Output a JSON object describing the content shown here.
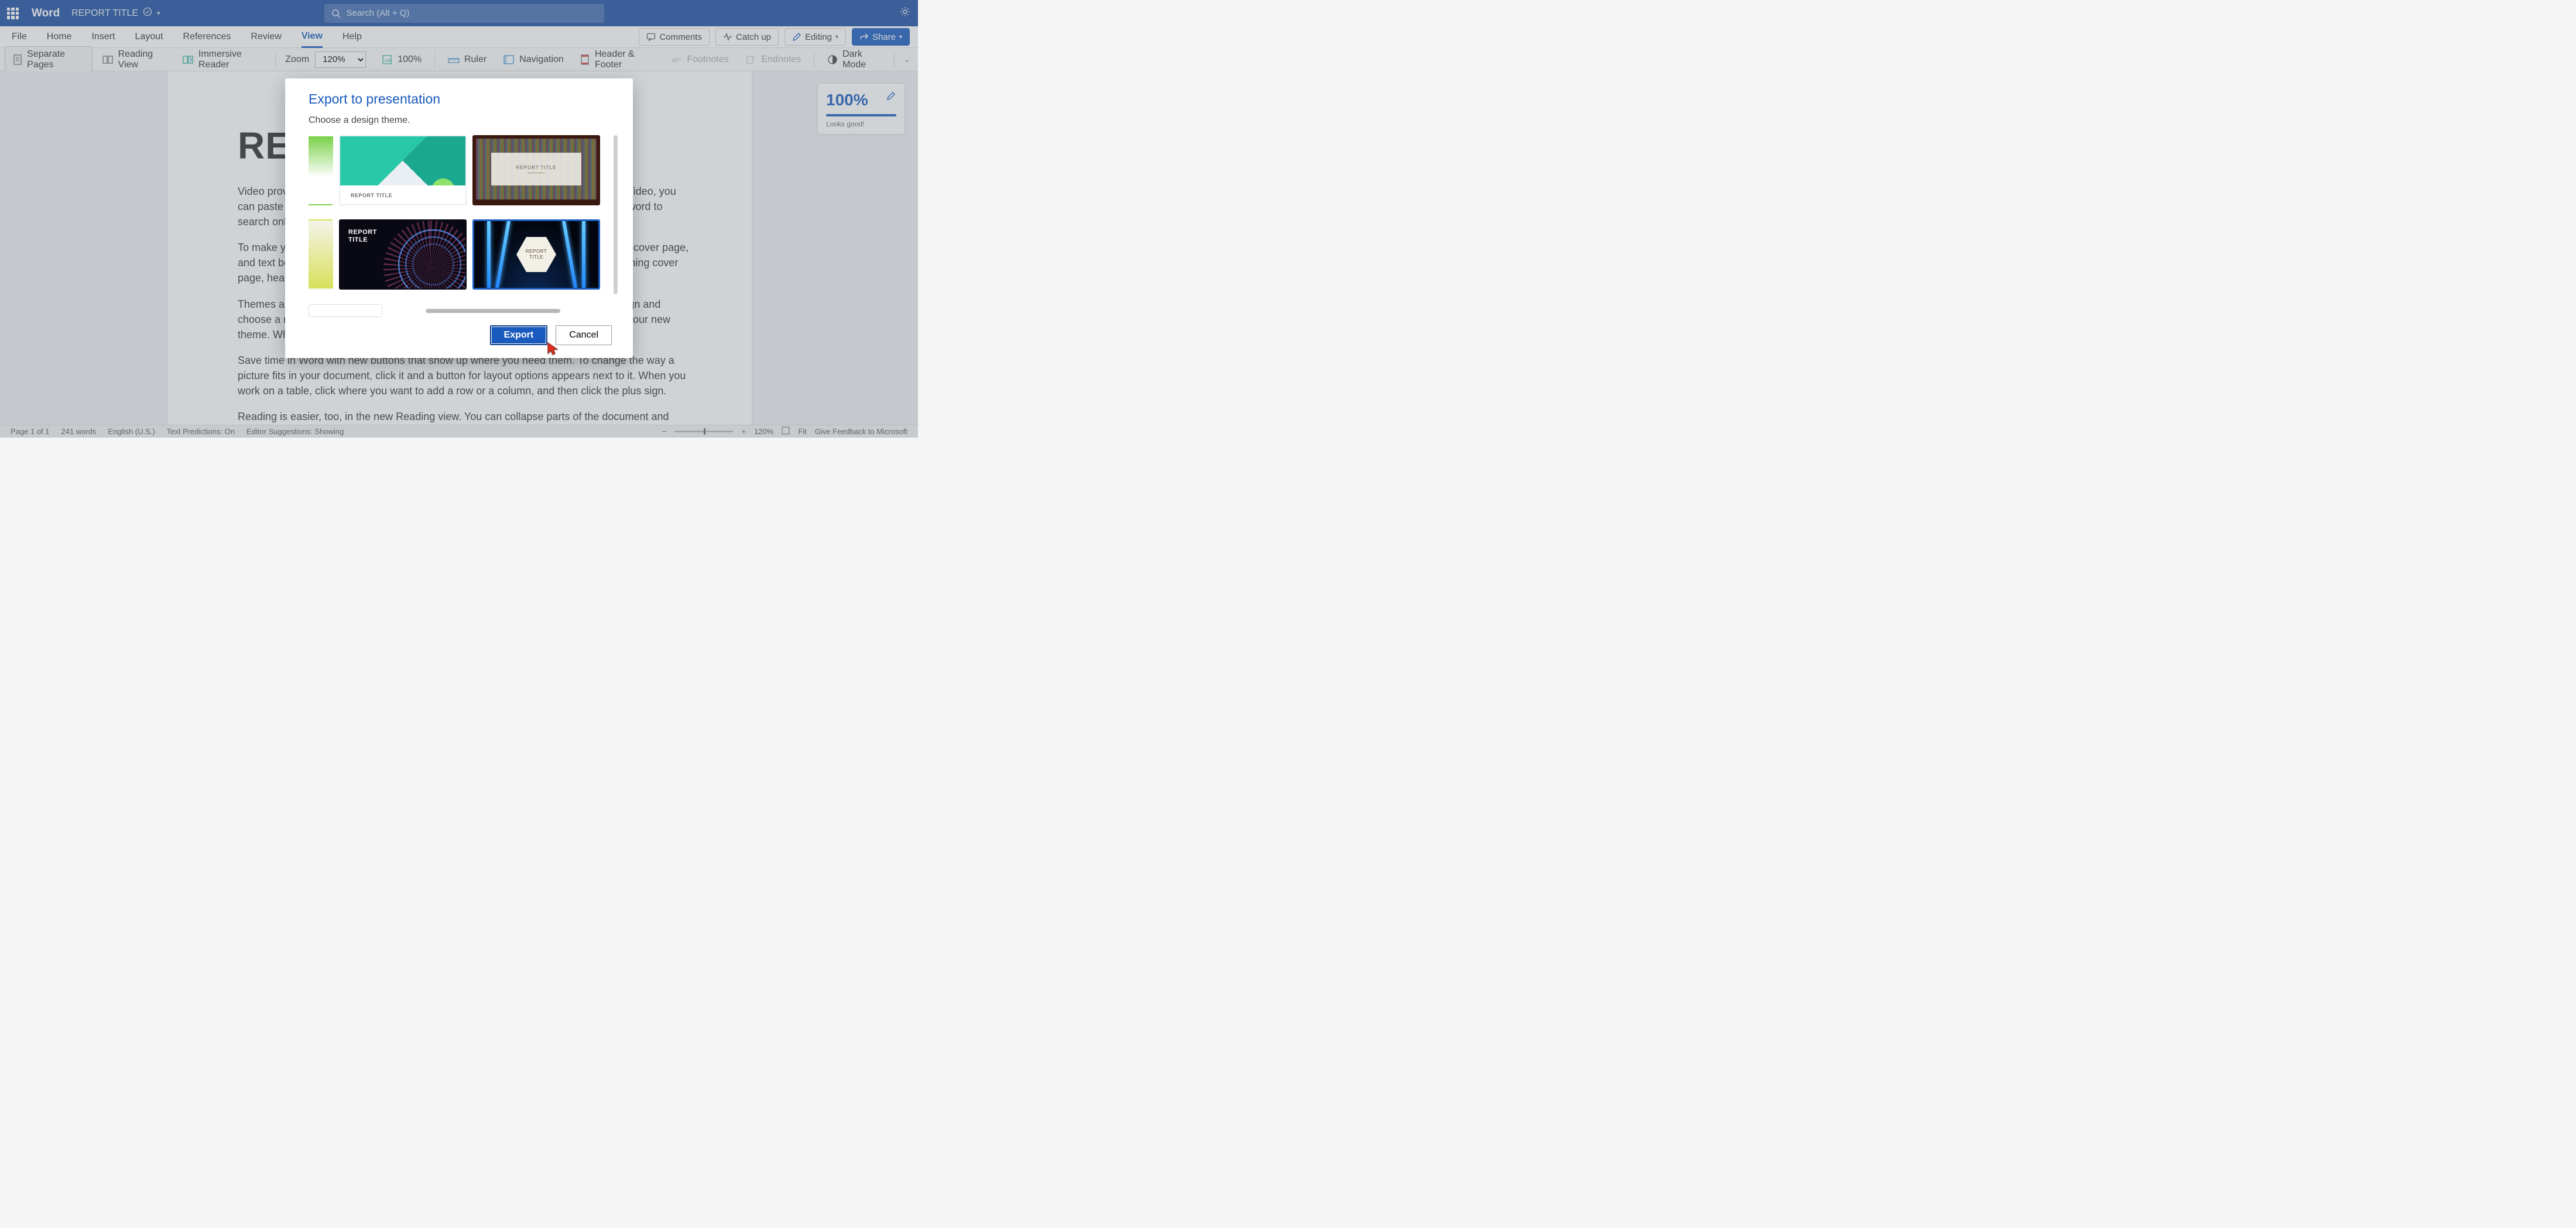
{
  "app": {
    "name": "Word",
    "doc_title": "REPORT TITLE"
  },
  "search": {
    "placeholder": "Search (Alt + Q)"
  },
  "tabs": [
    "File",
    "Home",
    "Insert",
    "Layout",
    "References",
    "Review",
    "View",
    "Help"
  ],
  "tabs_active": "View",
  "tab_actions": {
    "comments": "Comments",
    "catchup": "Catch up",
    "editing": "Editing",
    "share": "Share"
  },
  "ribbon": {
    "separate_pages": "Separate Pages",
    "reading_view": "Reading View",
    "immersive": "Immersive Reader",
    "zoom_label": "Zoom",
    "zoom_value": "120%",
    "hundred": "100%",
    "ruler": "Ruler",
    "navigation": "Navigation",
    "header_footer": "Header & Footer",
    "footnotes": "Footnotes",
    "endnotes": "Endnotes",
    "dark_mode": "Dark Mode"
  },
  "document": {
    "heading": "RE",
    "p1": "Video provides a powerful way to help you prove your point. When you click Online Video, you can paste in the embed code for the video you want to add. You can also type a keyword to search online for the video that best fits your document.",
    "p2": "To make your document look professionally produced, Word provides header, footer, cover page, and text box designs that complement each other. For example, you can add a matching cover page, header, and sidebar.",
    "p3": "Themes and styles also help keep your document coordinated. When you click Design and choose a new Theme, the pictures, charts, and SmartArt graphics change to match your new theme. When you apply styles, your headings change to match the new theme.",
    "p4": "Save time in Word with new buttons that show up where you need them. To change the way a picture fits in your document, click it and a button for layout options appears next to it. When you work on a table, click where you want to add a row or a column, and then click the plus sign.",
    "p5": "Reading is easier, too, in the new Reading view. You can collapse parts of the document and focus on the text you want. If you need to stop reading before you reach the end, Word remembers where you left off - even on another device."
  },
  "editor": {
    "score": "100%",
    "msg": "Looks good!"
  },
  "status": {
    "page": "Page 1 of 1",
    "words": "241 words",
    "lang": "English (U.S.)",
    "pred": "Text Predictions: On",
    "sugg": "Editor Suggestions: Showing",
    "zoom": "120%",
    "fit": "Fit",
    "feedback": "Give Feedback to Microsoft"
  },
  "dialog": {
    "title": "Export to presentation",
    "subtitle": "Choose a design theme.",
    "theme_label": "REPORT TITLE",
    "theme_label_2line": "REPORT\nTITLE",
    "export": "Export",
    "cancel": "Cancel"
  }
}
